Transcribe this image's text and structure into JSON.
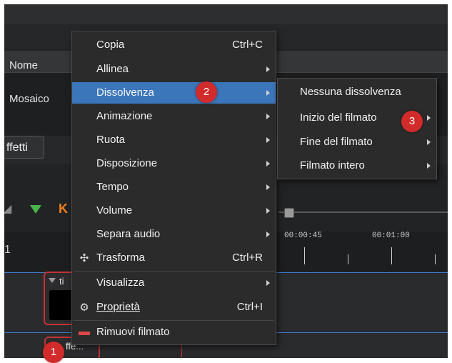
{
  "files_panel": {
    "header_name": "Nome",
    "row_name": "Mosaico"
  },
  "tabs": {
    "effects_tab": "ffetti"
  },
  "timeline": {
    "ruler_left": "1",
    "time_labels": [
      "00:00:45",
      "00:01:00"
    ],
    "clip1_title": "ti",
    "clip2_title": "ffe..."
  },
  "context_menu": {
    "items": [
      {
        "label": "Copia",
        "shortcut": "Ctrl+C"
      },
      {
        "label": "Allinea"
      },
      {
        "label": "Dissolvenza"
      },
      {
        "label": "Animazione"
      },
      {
        "label": "Ruota"
      },
      {
        "label": "Disposizione"
      },
      {
        "label": "Tempo"
      },
      {
        "label": "Volume"
      },
      {
        "label": "Separa audio"
      },
      {
        "label": "Trasforma",
        "shortcut": "Ctrl+R",
        "icon": "move-icon"
      },
      {
        "label": "Visualizza"
      },
      {
        "label": "Proprietà",
        "shortcut": "Ctrl+I",
        "icon": "gear-icon"
      },
      {
        "label": "Rimuovi filmato",
        "icon": "remove-icon"
      }
    ]
  },
  "submenu": {
    "items": [
      {
        "label": "Nessuna dissolvenza"
      },
      {
        "label": "Inizio del filmato"
      },
      {
        "label": "Fine del filmato"
      },
      {
        "label": "Filmato intero"
      }
    ]
  },
  "badges": [
    "1",
    "2",
    "3"
  ],
  "colors": {
    "accent": "#3c76ba",
    "badge": "#d22b2b",
    "clip_border": "#c43333"
  }
}
